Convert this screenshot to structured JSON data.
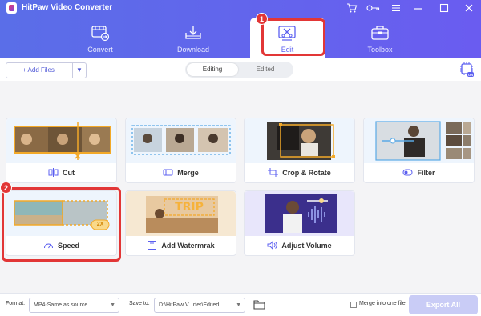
{
  "window": {
    "title": "HitPaw Video Converter"
  },
  "colors": {
    "accent": "#5b5ff0",
    "header_start": "#5a6ee8",
    "header_end": "#6a5cf0",
    "highlight": "#e23636"
  },
  "header": {
    "icons": [
      "cart-icon",
      "key-icon",
      "menu-icon",
      "minimize-icon",
      "maximize-icon",
      "close-icon"
    ],
    "tabs": [
      {
        "label": "Convert",
        "icon": "convert-icon",
        "active": false
      },
      {
        "label": "Download",
        "icon": "download-icon",
        "active": false
      },
      {
        "label": "Edit",
        "icon": "edit-icon",
        "active": true
      },
      {
        "label": "Toolbox",
        "icon": "toolbox-icon",
        "active": false
      }
    ]
  },
  "toolbar": {
    "add_files_label": "+ Add Files",
    "segments": [
      {
        "label": "Editing",
        "active": true
      },
      {
        "label": "Edited",
        "active": false
      }
    ],
    "hardware_icon": "hardware-acceleration-icon"
  },
  "tools": [
    {
      "label": "Cut",
      "icon": "cut-icon"
    },
    {
      "label": "Merge",
      "icon": "merge-icon"
    },
    {
      "label": "Crop & Rotate",
      "icon": "crop-icon"
    },
    {
      "label": "Filter",
      "icon": "filter-icon"
    },
    {
      "label": "Speed",
      "icon": "speed-icon",
      "thumb_badge": "2X"
    },
    {
      "label": "Add Watermrak",
      "icon": "watermark-icon",
      "thumb_text": "TRIP"
    },
    {
      "label": "Adjust Volume",
      "icon": "volume-icon"
    }
  ],
  "annotations": [
    {
      "number": "1"
    },
    {
      "number": "2"
    }
  ],
  "footer": {
    "format_label": "Format:",
    "format_value": "MP4-Same as source",
    "save_label": "Save to:",
    "save_value": "D:\\HitPaw V...rter\\Edited",
    "merge_label": "Merge into one file",
    "export_label": "Export All"
  }
}
